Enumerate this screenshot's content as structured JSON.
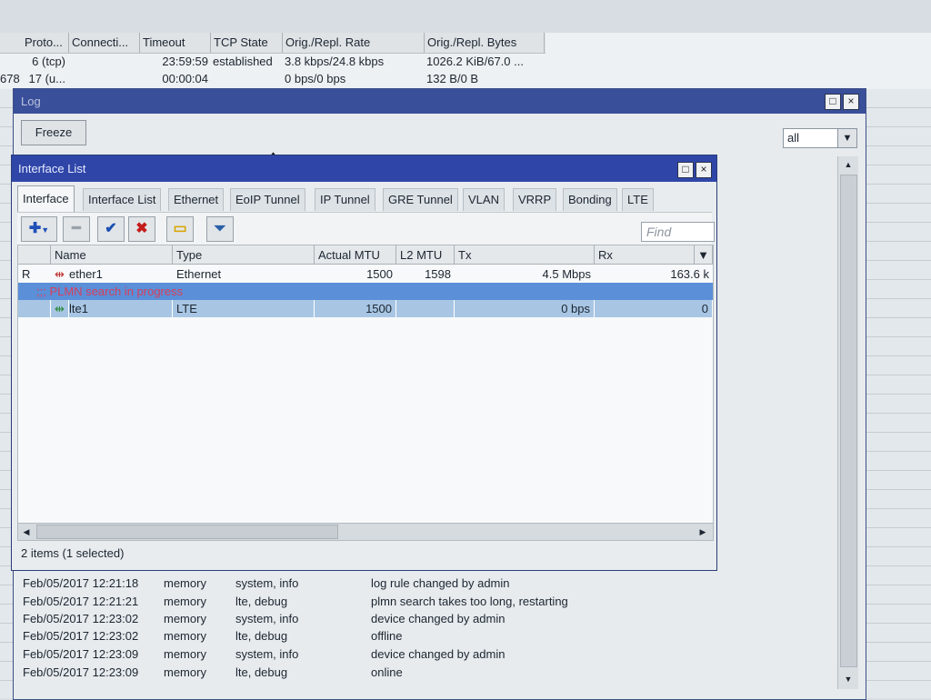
{
  "connections": {
    "columns": [
      "Proto...",
      "Connecti...",
      "Timeout",
      "TCP State",
      "Orig./Repl. Rate",
      "Orig./Repl. Bytes"
    ],
    "rows": [
      {
        "id": "",
        "proto": "6 (tcp)",
        "timeout": "23:59:59",
        "state": "established",
        "rate": "3.8 kbps/24.8 kbps",
        "bytes": "1026.2 KiB/67.0 ..."
      },
      {
        "id": "678",
        "proto": "17 (u...",
        "timeout": "00:00:04",
        "state": "",
        "rate": "0 bps/0 bps",
        "bytes": "132 B/0 B"
      }
    ]
  },
  "log_window": {
    "title": "Log",
    "freeze_label": "Freeze",
    "filter_value": "all",
    "entries": [
      {
        "time": "Feb/05/2017 12:21:18",
        "buffer": "memory",
        "topics": "system, info",
        "message": "log rule changed by admin"
      },
      {
        "time": "Feb/05/2017 12:21:21",
        "buffer": "memory",
        "topics": "lte, debug",
        "message": "plmn search takes too long, restarting"
      },
      {
        "time": "Feb/05/2017 12:23:02",
        "buffer": "memory",
        "topics": "system, info",
        "message": "device changed by admin"
      },
      {
        "time": "Feb/05/2017 12:23:02",
        "buffer": "memory",
        "topics": "lte, debug",
        "message": "offline"
      },
      {
        "time": "Feb/05/2017 12:23:09",
        "buffer": "memory",
        "topics": "system, info",
        "message": "device changed by admin"
      },
      {
        "time": "Feb/05/2017 12:23:09",
        "buffer": "memory",
        "topics": "lte, debug",
        "message": "online"
      }
    ]
  },
  "interface_window": {
    "title": "Interface List",
    "tabs": [
      "Interface",
      "Interface List",
      "Ethernet",
      "EoIP Tunnel",
      "IP Tunnel",
      "GRE Tunnel",
      "VLAN",
      "VRRP",
      "Bonding",
      "LTE"
    ],
    "active_tab": "Interface",
    "find_placeholder": "Find",
    "columns": [
      "Name",
      "Type",
      "Actual MTU",
      "L2 MTU",
      "Tx",
      "Rx"
    ],
    "rows": [
      {
        "flag": "R",
        "name": "ether1",
        "type": "Ethernet",
        "actual_mtu": "1500",
        "l2_mtu": "1598",
        "tx": "4.5 Mbps",
        "rx": "163.6 k"
      },
      {
        "comment": ";;; PLMN search in progress"
      },
      {
        "flag": "",
        "name": "lte1",
        "type": "LTE",
        "actual_mtu": "1500",
        "l2_mtu": "",
        "tx": "0 bps",
        "rx": "0"
      }
    ],
    "status": "2 items (1 selected)"
  },
  "colors": {
    "titlebar_active": "#2f46a8",
    "titlebar_inactive": "#3a4f9a",
    "selected_row": "#a8c6e4",
    "comment_row": "#5b8fd8",
    "comment_text": "#d6405a"
  }
}
